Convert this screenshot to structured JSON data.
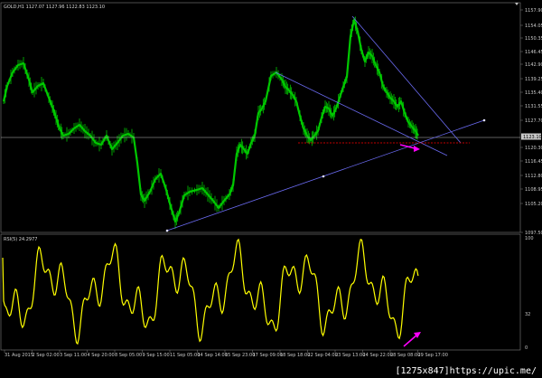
{
  "main_chart": {
    "symbol_label": "GOLD,H1  1127.07  1127.96  1122.83  1123.10",
    "price_axis": [
      "1157.90",
      "1154.05",
      "1150.35",
      "1146.45",
      "1142.90",
      "1139.25",
      "1135.40",
      "1131.55",
      "1127.70",
      "1120.30",
      "1116.45",
      "1112.80",
      "1108.95",
      "1105.20",
      "1097.50"
    ],
    "current_price": "1123.10",
    "colors": {
      "candles": "#00c800",
      "trendlines": "#6a6af0",
      "current_line": "#c0c0c0",
      "level": "#c00000",
      "arrow": "#ff00ff"
    }
  },
  "rsi": {
    "label": "RSI(5) 24.2977",
    "axis": [
      "100",
      "32",
      "0"
    ],
    "color": "#ffff00"
  },
  "time_axis": [
    "31 Aug 2015",
    "2 Sep 02:00",
    "3 Sep 11:00",
    "4 Sep 20:00",
    "8 Sep 05:00",
    "9 Sep 15:00",
    "11 Sep 05:00",
    "14 Sep 14:00",
    "15 Sep 23:00",
    "17 Sep 09:00",
    "18 Sep 18:00",
    "22 Sep 04:00",
    "23 Sep 13:00",
    "24 Sep 22:00",
    "28 Sep 08:00",
    "29 Sep 17:00"
  ],
  "watermark": "[1275x847]https://upic.me/"
}
